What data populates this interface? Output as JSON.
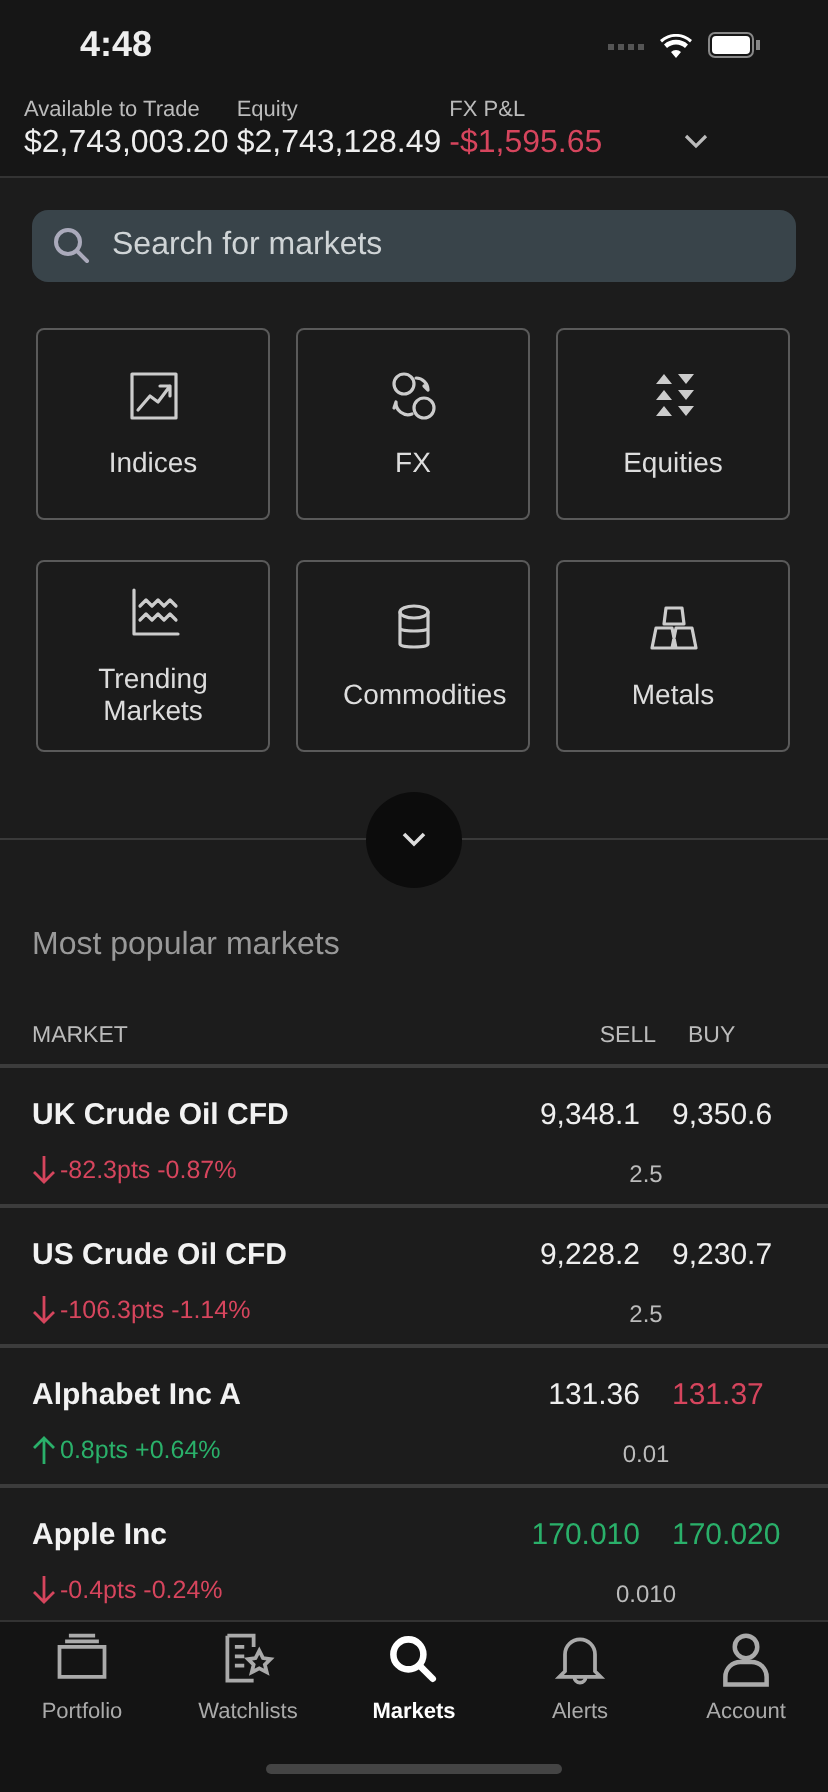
{
  "status_bar": {
    "time": "4:48"
  },
  "account_summary": [
    {
      "label": "Available to Trade",
      "value": "$2,743,003.20",
      "color": "#eeeeee"
    },
    {
      "label": "Equity",
      "value": "$2,743,128.49",
      "color": "#eeeeee"
    },
    {
      "label": "FX P&L",
      "value": "-$1,595.65",
      "color": "#d6455d"
    }
  ],
  "search": {
    "placeholder": "Search for markets"
  },
  "categories": [
    {
      "label": "Indices",
      "kind": "indices"
    },
    {
      "label": "FX",
      "kind": "fx"
    },
    {
      "label": "Equities",
      "kind": "equities"
    },
    {
      "label": "Trending Markets",
      "kind": "trending"
    },
    {
      "label": "Commodities",
      "kind": "commodities"
    },
    {
      "label": "Metals",
      "kind": "metals"
    }
  ],
  "section_title": "Most popular markets",
  "table": {
    "columns": [
      "MARKET",
      "SELL",
      "BUY"
    ],
    "rows": [
      {
        "market": "UK Crude Oil CFD",
        "change": "-82.3pts -0.87%",
        "kind": "down",
        "sell": {
          "text": "9,348.1",
          "color": "#eeeeee"
        },
        "buy": {
          "text": "9,350.6",
          "color": "#eeeeee"
        },
        "spread": "2.5"
      },
      {
        "market": "US Crude Oil CFD",
        "change": "-106.3pts -1.14%",
        "kind": "down",
        "sell": {
          "text": "9,228.2",
          "color": "#eeeeee"
        },
        "buy": {
          "text": "9,230.7",
          "color": "#eeeeee"
        },
        "spread": "2.5"
      },
      {
        "market": "Alphabet Inc A",
        "change": "0.8pts +0.64%",
        "kind": "up",
        "sell": {
          "text": "131.36",
          "color": "#eeeeee"
        },
        "buy": {
          "text": "131.37",
          "color": "#d6455d"
        },
        "spread": "0.01"
      },
      {
        "market": "Apple Inc",
        "change": "-0.4pts -0.24%",
        "kind": "down",
        "sell": {
          "text": "170.010",
          "color": "#2ab06a"
        },
        "buy": {
          "text": "170.020",
          "color": "#2ab06a"
        },
        "spread": "0.010"
      }
    ]
  },
  "tab_bar": [
    {
      "label": "Portfolio",
      "kind": "portfolio",
      "selected": false
    },
    {
      "label": "Watchlists",
      "kind": "watchlists",
      "selected": false
    },
    {
      "label": "Markets",
      "kind": "markets",
      "selected": true
    },
    {
      "label": "Alerts",
      "kind": "alerts",
      "selected": false
    },
    {
      "label": "Account",
      "kind": "account",
      "selected": false
    }
  ]
}
